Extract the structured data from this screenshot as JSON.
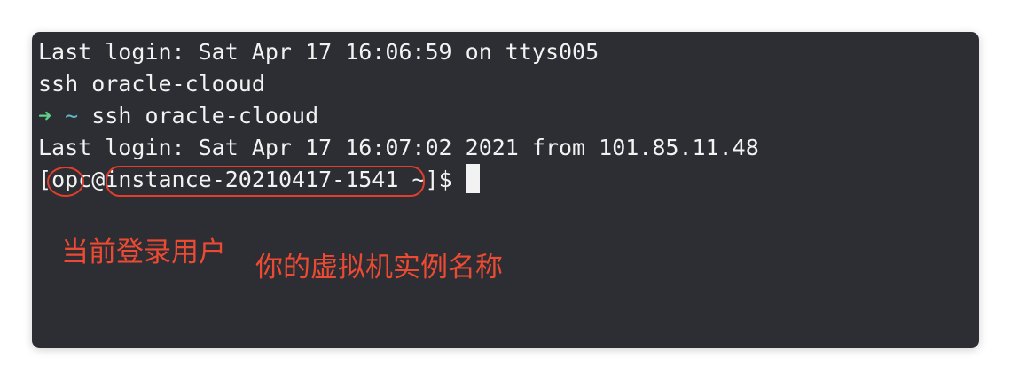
{
  "terminal": {
    "lines": [
      "Last login: Sat Apr 17 16:06:59 on ttys005",
      "ssh oracle-clooud",
      "ssh oracle-clooud",
      "Last login: Sat Apr 17 16:07:02 2021 from 101.85.11.48"
    ],
    "prompt_symbol": "➜",
    "prompt_dir": "~",
    "remote_prompt": {
      "open_bracket": "[",
      "user": "opc",
      "at": "@",
      "host": "instance-20210417-1541",
      "path": " ~]$ "
    }
  },
  "annotations": {
    "user_label": "当前登录用户",
    "instance_label": "你的虚拟机实例名称",
    "color": "#ec4a33"
  }
}
